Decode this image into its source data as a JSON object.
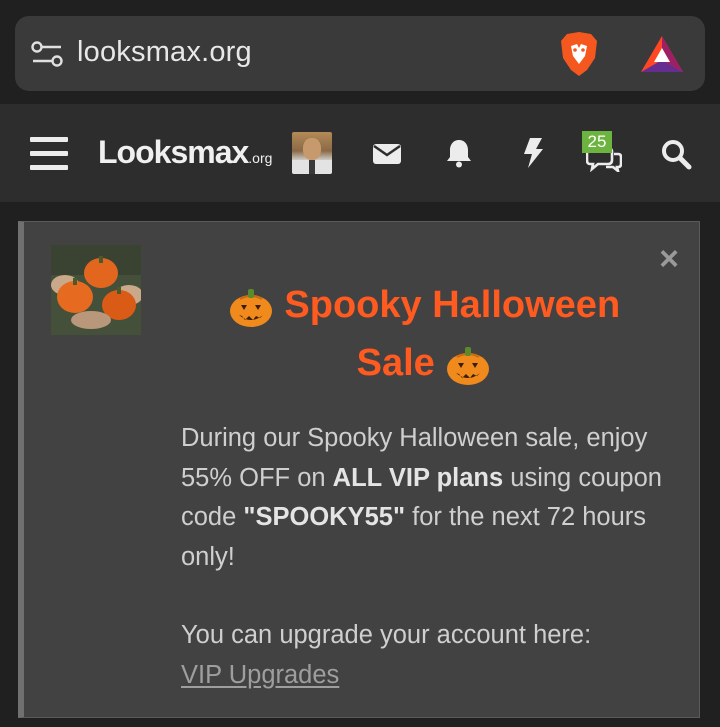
{
  "browser": {
    "url": "looksmax.org",
    "icons": [
      "site-settings-icon",
      "brave-shields-icon",
      "brave-rewards-icon"
    ]
  },
  "header": {
    "logo_main": "Looksmax",
    "logo_suffix": ".org",
    "chat_badge_count": "25",
    "icons": [
      "hamburger-menu-icon",
      "avatar",
      "mail-icon",
      "bell-icon",
      "bolt-icon",
      "chat-icon",
      "search-icon"
    ]
  },
  "notice": {
    "title_part1": "Spooky Halloween",
    "title_part2": "Sale",
    "body_intro": "During our Spooky Halloween sale, enjoy 55% OFF on ",
    "body_bold1": "ALL VIP plans",
    "body_mid": " using coupon code ",
    "body_bold2": "\"SPOOKY55\"",
    "body_end": " for the next 72 hours only!",
    "upgrade_text": "You can upgrade your account here:",
    "upgrade_link": "VIP Upgrades",
    "close_glyph": "×"
  },
  "colors": {
    "title_orange": "#ff5a1f",
    "badge_green": "#6cb33f",
    "card_bg": "#424242"
  }
}
